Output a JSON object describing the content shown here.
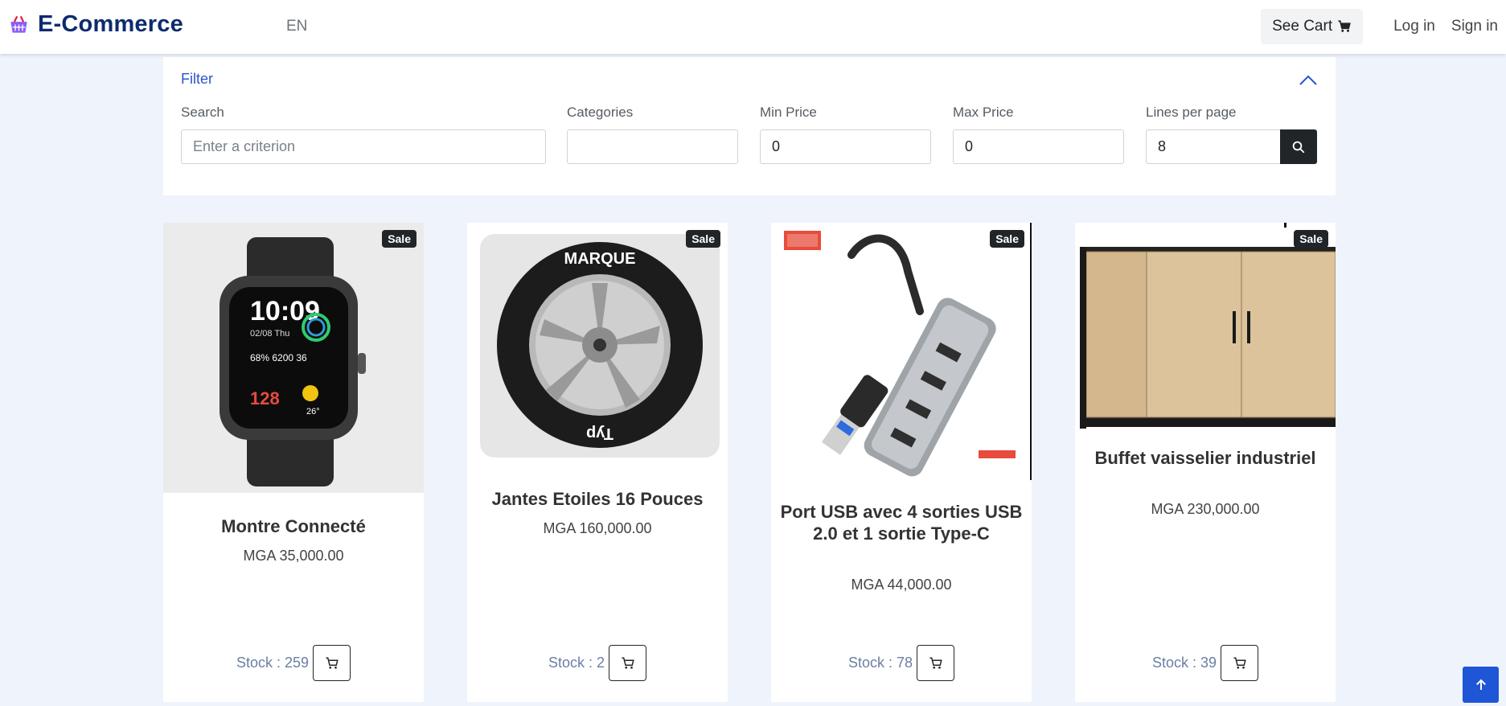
{
  "navbar": {
    "brand_icon": "basket-icon",
    "brand": "E-Commerce",
    "language": "EN",
    "see_cart": "See Cart",
    "see_cart_icon": "cart-icon",
    "login": "Log in",
    "signin": "Sign in"
  },
  "filter": {
    "title": "Filter",
    "toggle_icon": "chevron-up-icon",
    "search": {
      "label": "Search",
      "placeholder": "Enter a criterion",
      "value": ""
    },
    "categories": {
      "label": "Categories",
      "value": ""
    },
    "min_price": {
      "label": "Min Price",
      "value": "0"
    },
    "max_price": {
      "label": "Max Price",
      "value": "0"
    },
    "lines_per_page": {
      "label": "Lines per page",
      "value": "8"
    },
    "search_button_icon": "search-icon"
  },
  "products": [
    {
      "title": "Montre Connecté",
      "price": "MGA 35,000.00",
      "stock": "Stock : 259",
      "badge": "Sale",
      "image": "smartwatch-image"
    },
    {
      "title": "Jantes Etoiles 16 Pouces",
      "price": "MGA 160,000.00",
      "stock": "Stock : 2",
      "badge": "Sale",
      "image": "wheel-rim-image",
      "image_text": [
        "MARQUE",
        "Typ"
      ]
    },
    {
      "title": "Port USB avec 4 sorties USB 2.0 et 1 sortie Type-C",
      "price": "MGA 44,000.00",
      "stock": "Stock : 78",
      "badge": "Sale",
      "image": "usb-hub-image"
    },
    {
      "title": "Buffet vaisselier industriel",
      "price": "MGA 230,000.00",
      "stock": "Stock : 39",
      "badge": "Sale",
      "image": "sideboard-cabinet-image"
    }
  ],
  "scroll_top_icon": "arrow-up-icon",
  "colors": {
    "brand": "#0d2b6e",
    "accent": "#1f56d6",
    "dark": "#212529",
    "background": "#eff3fb"
  }
}
